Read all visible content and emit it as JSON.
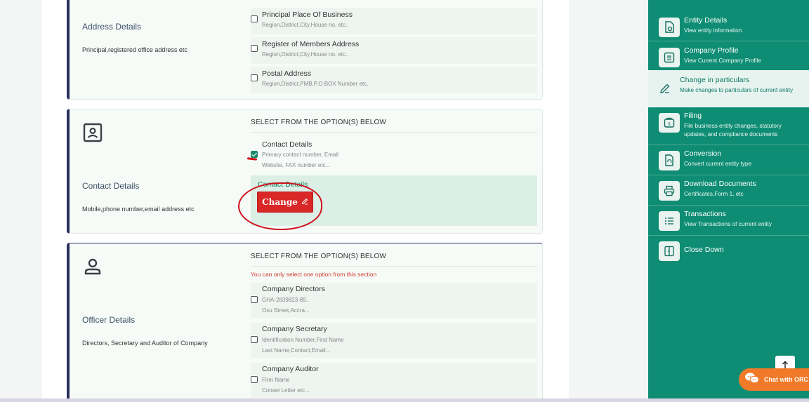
{
  "address_card": {
    "title": "Address Details",
    "subtitle": "Principal,registered office address etc",
    "options": [
      {
        "label": "Principal Place Of Business",
        "desc": "Region,District,City,House no. etc..",
        "checked": false
      },
      {
        "label": "Register of Members Address",
        "desc": "Region,District,City,House no. etc..",
        "checked": false
      },
      {
        "label": "Postal Address",
        "desc": "Region,District,PMB,P.O BOX Number etc..",
        "checked": false
      }
    ]
  },
  "contact_card": {
    "icon": "contact-card-icon",
    "title": "Contact Details",
    "subtitle": "Mobile,phone number,email address etc",
    "section_heading": "SELECT FROM THE OPTION(S) BELOW",
    "options": [
      {
        "label": "Contact Details",
        "desc_line1": "Primary contact number, Email",
        "desc_line2": "Website, FAX number etc...",
        "checked": true
      }
    ],
    "change_panel": {
      "label": "Contact Details",
      "button_label": "Change",
      "button_icon": "pencil-icon"
    }
  },
  "officer_card": {
    "icon": "person-icon",
    "title": "Officer Details",
    "subtitle": "Directors, Secretary and Auditor of Company",
    "section_heading": "SELECT FROM THE OPTION(S) BELOW",
    "warning": "You can only select one option from this section",
    "options": [
      {
        "label": "Company Directors",
        "desc_line1": "GHA-2839823-89..",
        "desc_line2": "Osu Street,Accra...",
        "checked": false
      },
      {
        "label": "Company Secretary",
        "desc_line1": "Identification Number,First Name",
        "desc_line2": "Last Name,Contact,Email...",
        "checked": false
      },
      {
        "label": "Company Auditor",
        "desc_line1": "Firm Name",
        "desc_line2": "Conset Letter etc...",
        "checked": false
      }
    ]
  },
  "sidebar": {
    "items": [
      {
        "title": "Entity Details",
        "desc": "View entity information",
        "icon": "document-view-icon",
        "active": false
      },
      {
        "title": "Company Profile",
        "desc": "View Current Company Profile",
        "icon": "profile-list-icon",
        "active": false
      },
      {
        "title": "Change in particulars",
        "desc": "Make changes to particulars of current entity",
        "icon": "edit-pencil-icon",
        "active": true
      },
      {
        "title": "Filing",
        "desc": "File business entity changes, statutory updates, and compliance documents",
        "icon": "filing-icon",
        "active": false
      },
      {
        "title": "Conversion",
        "desc": "Convert current entity type",
        "icon": "conversion-icon",
        "active": false
      },
      {
        "title": "Download Documents",
        "desc": "Certificates,Form 1, etc",
        "icon": "printer-icon",
        "active": false
      },
      {
        "title": "Transactions",
        "desc": "View Transactions of current entity",
        "icon": "transactions-list-icon",
        "active": false
      },
      {
        "title": "Close Down",
        "desc": "",
        "icon": "close-down-icon",
        "active": false
      }
    ]
  },
  "chat": {
    "label": "Chat with ORC",
    "icon": "chat-bubbles-icon"
  },
  "scroll_top": {
    "icon": "arrow-up-icon"
  },
  "colors": {
    "sidebar": "#0f8d74",
    "accent_red": "#d92626",
    "card_border": "#2a2d5c",
    "chat": "#f07a28"
  }
}
